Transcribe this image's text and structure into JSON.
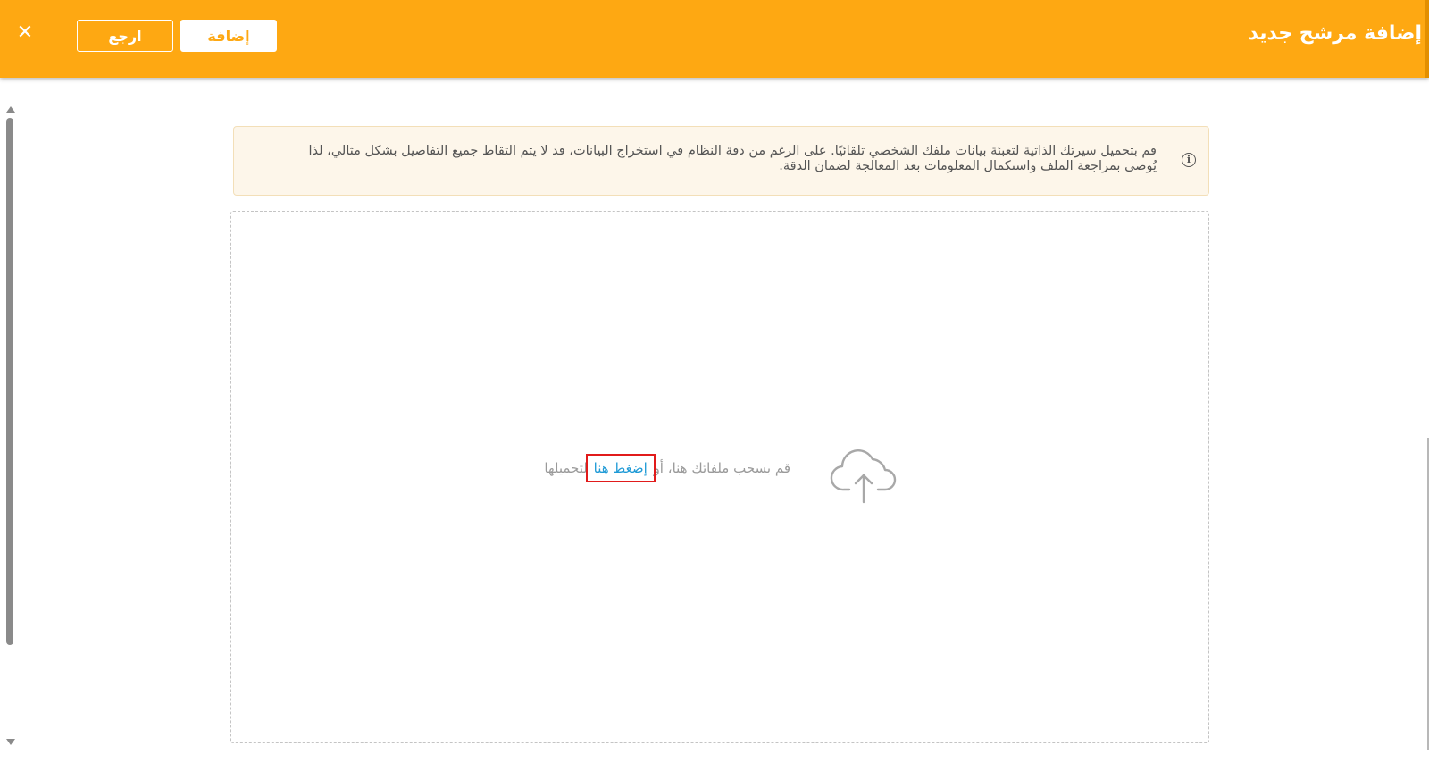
{
  "header": {
    "title": "إضافة مرشح جديد",
    "add_button_label": "إضافة",
    "back_button_label": "ارجع",
    "close_icon": "close-icon",
    "close_glyph": "✕"
  },
  "notice": {
    "icon": "info-icon",
    "icon_glyph": "i",
    "text": "قم بتحميل سيرتك الذاتية لتعبئة بيانات ملفك الشخصي تلقائيًا. على الرغم من دقة النظام في استخراج البيانات، قد لا يتم التقاط جميع التفاصيل بشكل مثالي، لذا يُوصى بمراجعة الملف واستكمال المعلومات بعد المعالجة لضمان الدقة."
  },
  "upload": {
    "icon": "cloud-upload-icon",
    "text_before": "قم بسحب ملفاتك هنا، أو",
    "link_label": "إضغط هنا",
    "text_after": "لتحميلها"
  },
  "colors": {
    "header_bg": "#fea812",
    "link": "#1f9ad6",
    "highlight": "#e11b1b",
    "notice_bg": "#fdf6ea"
  }
}
